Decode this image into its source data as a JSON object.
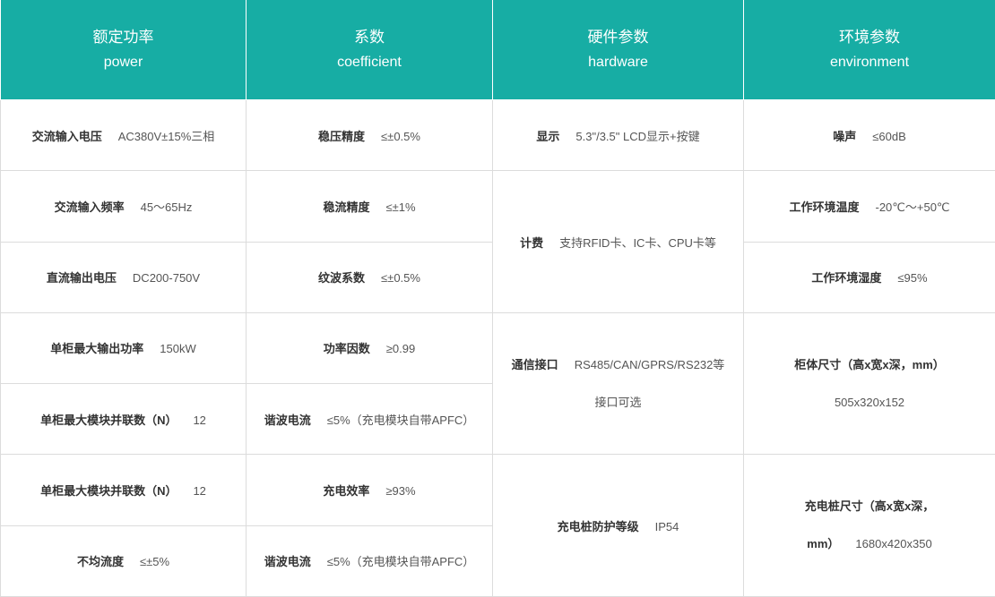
{
  "headers": [
    {
      "cn": "额定功率",
      "en": "power"
    },
    {
      "cn": "系数",
      "en": "coefficient"
    },
    {
      "cn": "硬件参数",
      "en": "hardware"
    },
    {
      "cn": "环境参数",
      "en": "environment"
    }
  ],
  "power": [
    {
      "label": "交流输入电压",
      "value": "AC380V±15%三相"
    },
    {
      "label": "交流输入频率",
      "value": "45～65Hz"
    },
    {
      "label": "直流输出电压",
      "value": "DC200-750V"
    },
    {
      "label": "单柜最大输出功率",
      "value": "150kW"
    },
    {
      "label": "单柜最大模块并联数（N）",
      "value": "12"
    },
    {
      "label": "单柜最大模块并联数（N）",
      "value": "12"
    },
    {
      "label": "不均流度",
      "value": "≤±5%"
    }
  ],
  "coefficient": [
    {
      "label": "稳压精度",
      "value": "≤±0.5%"
    },
    {
      "label": "稳流精度",
      "value": "≤±1%"
    },
    {
      "label": "纹波系数",
      "value": "≤±0.5%"
    },
    {
      "label": "功率因数",
      "value": "≥0.99"
    },
    {
      "label": "谐波电流",
      "value": "≤5%（充电模块自带APFC）"
    },
    {
      "label": "充电效率",
      "value": "≥93%"
    },
    {
      "label": "谐波电流",
      "value": "≤5%（充电模块自带APFC）"
    }
  ],
  "hardware": [
    {
      "label": "显示",
      "value": "5.3\"/3.5\" LCD显示+按键"
    },
    {
      "label": "计费",
      "value": "支持RFID卡、IC卡、CPU卡等"
    },
    {
      "label": "通信接口",
      "value": "RS485/CAN/GPRS/RS232等",
      "value2": "接口可选"
    },
    {
      "label": "充电桩防护等级",
      "value": "IP54"
    }
  ],
  "environment": [
    {
      "label": "噪声",
      "value": "≤60dB"
    },
    {
      "label": "工作环境温度",
      "value": "-20℃～+50℃"
    },
    {
      "label": "工作环境湿度",
      "value": "≤95%"
    },
    {
      "label": "柜体尺寸（高x宽x深，mm）",
      "value": "505x320x152"
    },
    {
      "label": "充电桩尺寸（高x宽x深，",
      "label2": "mm）",
      "value": "1680x420x350"
    }
  ]
}
